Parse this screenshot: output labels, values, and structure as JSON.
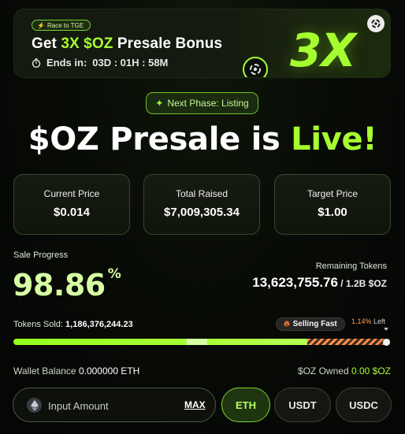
{
  "banner": {
    "badge": "Race to TGE",
    "title_prefix": "Get ",
    "title_accent": "3X $OZ",
    "title_suffix": " Presale Bonus",
    "ends_label": "Ends in:",
    "countdown": "03D : 01H : 58M",
    "big_text": "3X"
  },
  "next_phase": "Next Phase: Listing",
  "headline": {
    "main": "$OZ Presale is ",
    "live": "Live!"
  },
  "stats": [
    {
      "label": "Current Price",
      "value": "$0.014"
    },
    {
      "label": "Total Raised",
      "value": "$7,009,305.34"
    },
    {
      "label": "Target Price",
      "value": "$1.00"
    }
  ],
  "progress": {
    "label": "Sale Progress",
    "percent": "98.86",
    "percent_sign": "%",
    "fill_fraction": 0.78,
    "remaining_label": "Remaining Tokens",
    "remaining_value": "13,623,755.76",
    "remaining_suffix": " / 1.2B $OZ",
    "sold_label": "Tokens Sold:",
    "sold_value": "1,186,376,244.23",
    "selling_fast": "Selling Fast",
    "left_pct": "1.14%",
    "left_word": "Left"
  },
  "balances": {
    "wallet_label": "Wallet Balance",
    "wallet_value": "0.000000 ETH",
    "owned_label": "$OZ Owned",
    "owned_value": "0.00 $OZ"
  },
  "purchase": {
    "input_placeholder": "Input Amount",
    "input_value": "",
    "max_label": "MAX",
    "tokens": [
      "ETH",
      "USDT",
      "USDC"
    ],
    "selected_token": "ETH"
  },
  "colors": {
    "accent": "#a6ff2f",
    "background": "#070a05",
    "warning": "#ff8f4a"
  }
}
